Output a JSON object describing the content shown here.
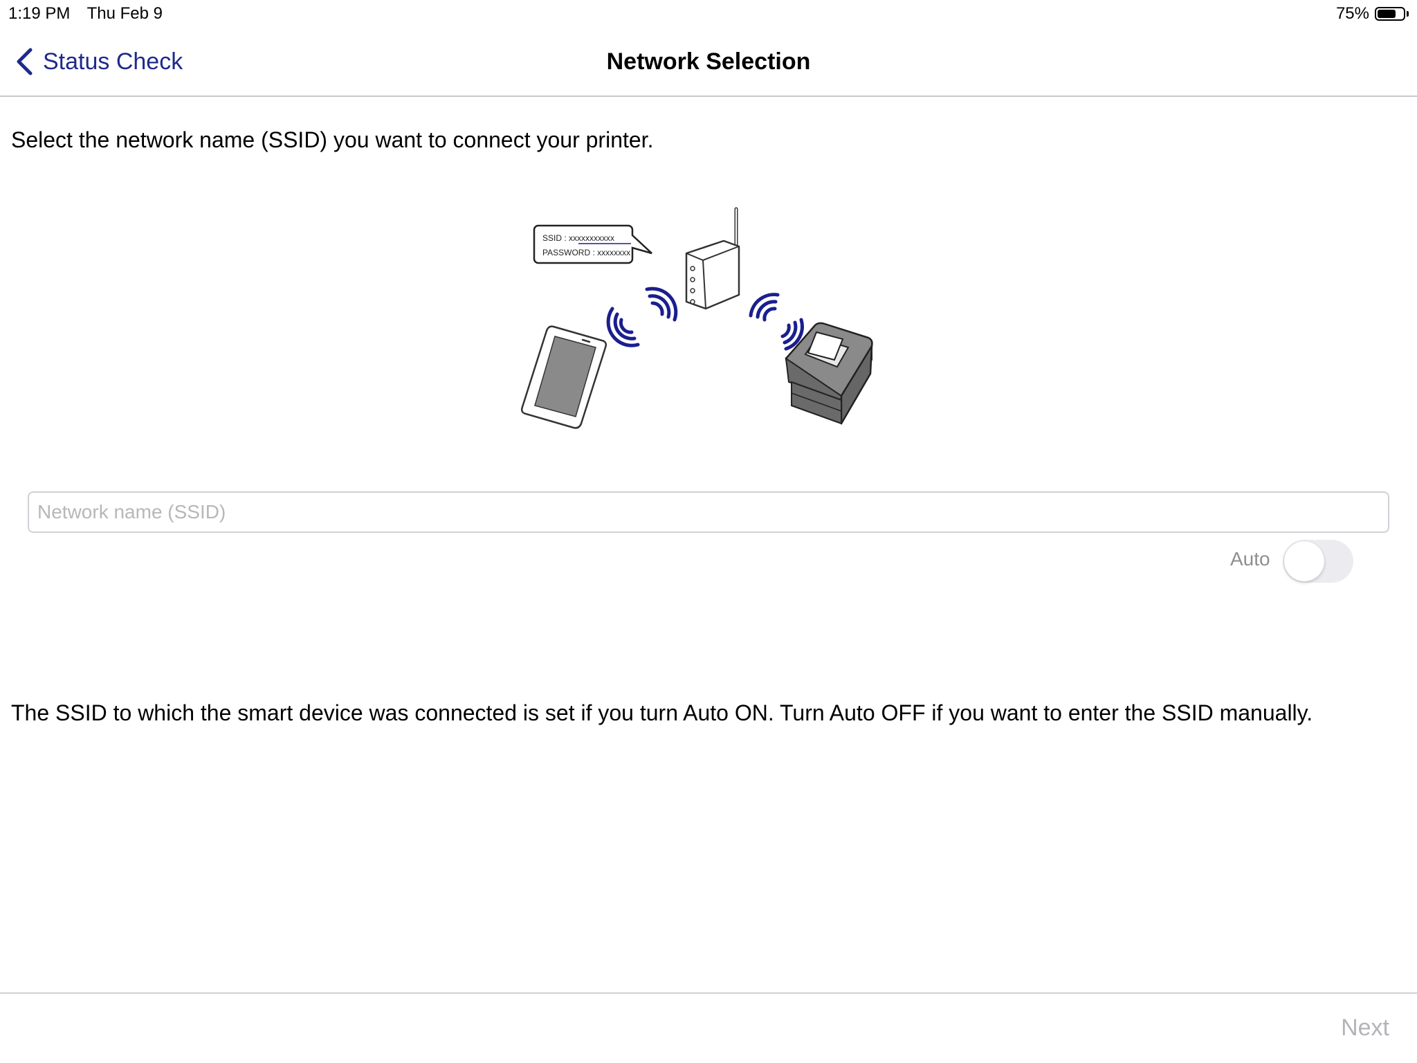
{
  "status_bar": {
    "time": "1:19 PM",
    "date": "Thu Feb 9",
    "battery_percent": "75%",
    "battery_level": 0.75
  },
  "nav": {
    "back_label": "Status Check",
    "title": "Network Selection"
  },
  "main": {
    "instruction": "Select the network name (SSID) you want to connect your printer.",
    "illustration": {
      "bubble_ssid": "SSID : xxxxxxxxxxx",
      "bubble_password": "PASSWORD : xxxxxxxx"
    },
    "ssid_input": {
      "placeholder": "Network name (SSID)",
      "value": ""
    },
    "auto_label": "Auto",
    "auto_on": false,
    "help_text": "The SSID to which the smart device was connected is set if you turn Auto ON. Turn Auto OFF if you want to enter the SSID manually."
  },
  "footer": {
    "next_label": "Next"
  },
  "colors": {
    "accent": "#1f2a8c",
    "wifi_waves": "#1a1f8f",
    "disabled": "#b4b4b8"
  }
}
